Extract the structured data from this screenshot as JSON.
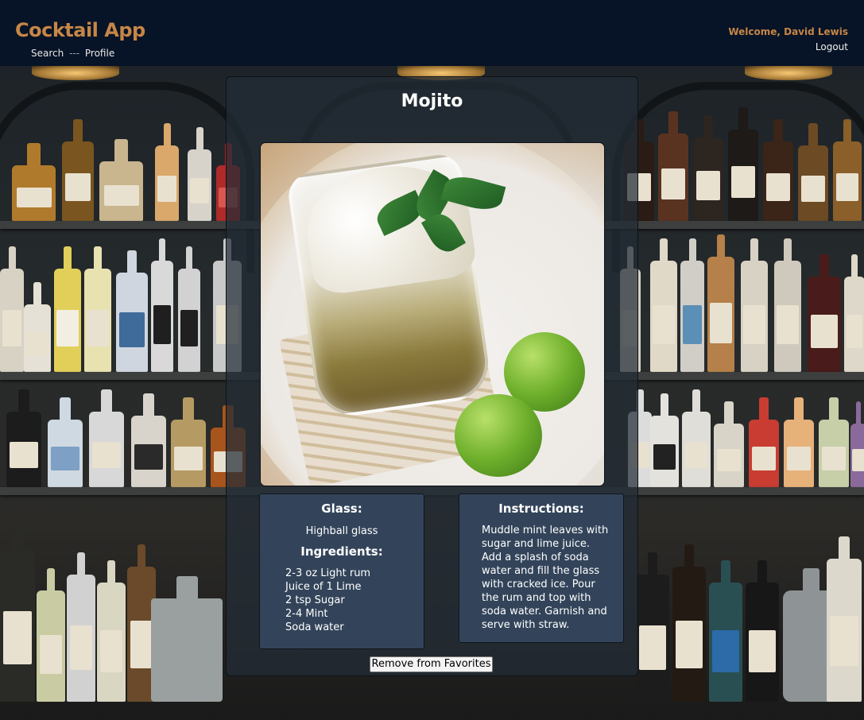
{
  "header": {
    "app_title": "Cocktail App",
    "nav": {
      "search_label": "Search",
      "separator": "---",
      "profile_label": "Profile"
    },
    "welcome_text": "Welcome, David Lewis",
    "logout_label": "Logout"
  },
  "drink": {
    "name": "Mojito",
    "glass_heading": "Glass:",
    "glass_value": "Highball glass",
    "ingredients_heading": "Ingredients:",
    "ingredients": [
      "2-3 oz Light rum",
      "Juice of 1 Lime",
      "2 tsp Sugar",
      "2-4 Mint",
      "Soda water"
    ],
    "instructions_heading": "Instructions:",
    "instructions": "Muddle mint leaves with sugar and lime juice. Add a splash of soda water and fill the glass with cracked ice. Pour the rum and top with soda water. Garnish and serve with straw."
  },
  "actions": {
    "remove_favorite_label": "Remove from Favorites"
  },
  "colors": {
    "header_bg": "#071326",
    "brand": "#c68647",
    "panel_bg": "#33445a"
  }
}
